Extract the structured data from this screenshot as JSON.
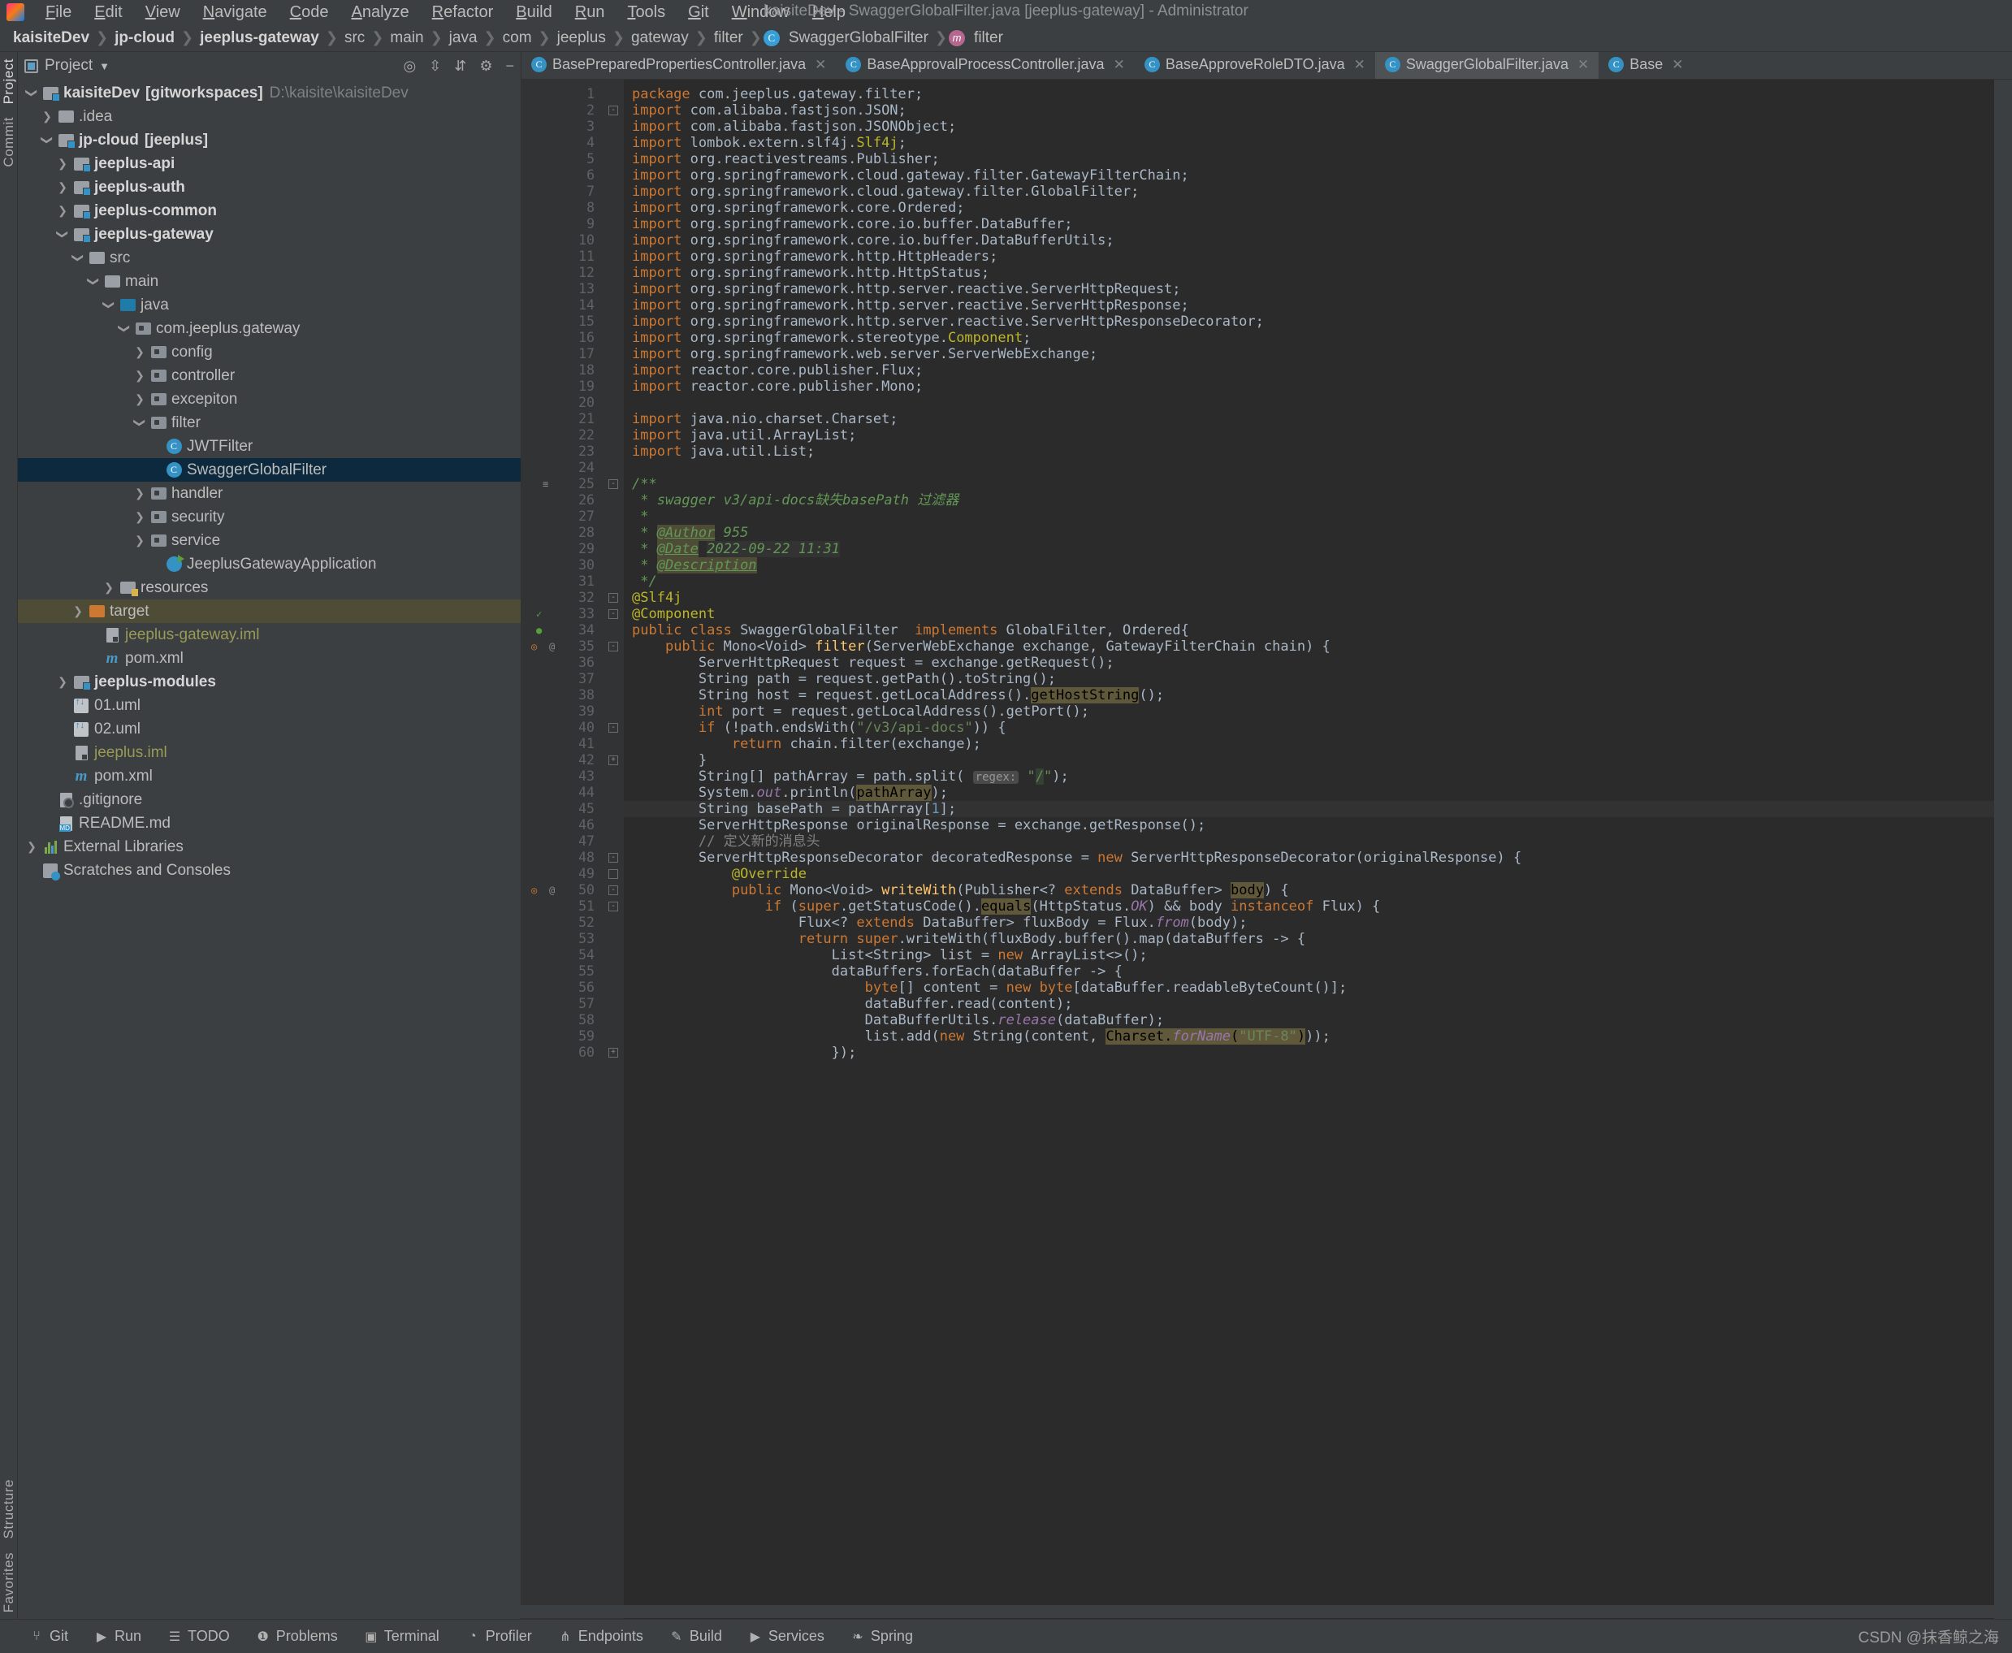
{
  "window": {
    "title": "kaisiteDev - SwaggerGlobalFilter.java [jeeplus-gateway] - Administrator"
  },
  "menubar": [
    {
      "label": "File"
    },
    {
      "label": "Edit"
    },
    {
      "label": "View"
    },
    {
      "label": "Navigate"
    },
    {
      "label": "Code"
    },
    {
      "label": "Analyze"
    },
    {
      "label": "Refactor"
    },
    {
      "label": "Build"
    },
    {
      "label": "Run"
    },
    {
      "label": "Tools"
    },
    {
      "label": "Git"
    },
    {
      "label": "Window"
    },
    {
      "label": "Help"
    }
  ],
  "breadcrumb": [
    {
      "label": "kaisiteDev",
      "bold": true
    },
    {
      "label": "jp-cloud",
      "bold": true
    },
    {
      "label": "jeeplus-gateway",
      "bold": true
    },
    {
      "label": "src",
      "bold": false
    },
    {
      "label": "main",
      "bold": false
    },
    {
      "label": "java",
      "bold": false
    },
    {
      "label": "com",
      "bold": false
    },
    {
      "label": "jeeplus",
      "bold": false
    },
    {
      "label": "gateway",
      "bold": false
    },
    {
      "label": "filter",
      "bold": false
    },
    {
      "label": "SwaggerGlobalFilter",
      "bold": false,
      "badge": "C"
    },
    {
      "label": "filter",
      "bold": false,
      "badge": "m"
    }
  ],
  "left_rail": {
    "top": [
      "Project",
      "Commit"
    ],
    "bottom": [
      "Structure",
      "Favorites"
    ]
  },
  "project_panel": {
    "title": "Project",
    "toolbar_icons": [
      "target-icon",
      "expand-all-icon",
      "collapse-all-icon",
      "gear-icon",
      "hide-icon"
    ],
    "tree": [
      {
        "depth": 0,
        "arrow": "down",
        "icon": "module",
        "label": "kaisiteDev",
        "bold": true,
        "suffix": "[gitworkspaces]",
        "path": "D:\\kaisite\\kaisiteDev"
      },
      {
        "depth": 1,
        "arrow": "right",
        "icon": "folder",
        "label": ".idea"
      },
      {
        "depth": 1,
        "arrow": "down",
        "icon": "module",
        "label": "jp-cloud",
        "bold": true,
        "suffix": "[jeeplus]"
      },
      {
        "depth": 2,
        "arrow": "right",
        "icon": "module",
        "label": "jeeplus-api",
        "bold": true
      },
      {
        "depth": 2,
        "arrow": "right",
        "icon": "module",
        "label": "jeeplus-auth",
        "bold": true
      },
      {
        "depth": 2,
        "arrow": "right",
        "icon": "module",
        "label": "jeeplus-common",
        "bold": true
      },
      {
        "depth": 2,
        "arrow": "down",
        "icon": "module",
        "label": "jeeplus-gateway",
        "bold": true
      },
      {
        "depth": 3,
        "arrow": "down",
        "icon": "folder",
        "label": "src"
      },
      {
        "depth": 4,
        "arrow": "down",
        "icon": "folder",
        "label": "main"
      },
      {
        "depth": 5,
        "arrow": "down",
        "icon": "source",
        "label": "java"
      },
      {
        "depth": 6,
        "arrow": "down",
        "icon": "package",
        "label": "com.jeeplus.gateway"
      },
      {
        "depth": 7,
        "arrow": "right",
        "icon": "package",
        "label": "config"
      },
      {
        "depth": 7,
        "arrow": "right",
        "icon": "package",
        "label": "controller"
      },
      {
        "depth": 7,
        "arrow": "right",
        "icon": "package",
        "label": "excepiton"
      },
      {
        "depth": 7,
        "arrow": "down",
        "icon": "package",
        "label": "filter"
      },
      {
        "depth": 8,
        "arrow": "none",
        "icon": "class",
        "label": "JWTFilter"
      },
      {
        "depth": 8,
        "arrow": "none",
        "icon": "class",
        "label": "SwaggerGlobalFilter",
        "selected": true
      },
      {
        "depth": 7,
        "arrow": "right",
        "icon": "package",
        "label": "handler"
      },
      {
        "depth": 7,
        "arrow": "right",
        "icon": "package",
        "label": "security"
      },
      {
        "depth": 7,
        "arrow": "right",
        "icon": "package",
        "label": "service"
      },
      {
        "depth": 8,
        "arrow": "none",
        "icon": "runclass",
        "label": "JeeplusGatewayApplication"
      },
      {
        "depth": 5,
        "arrow": "right",
        "icon": "resources",
        "label": "resources"
      },
      {
        "depth": 3,
        "arrow": "right",
        "icon": "target",
        "label": "target",
        "highlighted": true
      },
      {
        "depth": 4,
        "arrow": "none",
        "icon": "iml",
        "label": "jeeplus-gateway.iml",
        "olive": true
      },
      {
        "depth": 4,
        "arrow": "none",
        "icon": "maven",
        "label": "pom.xml"
      },
      {
        "depth": 2,
        "arrow": "right",
        "icon": "module",
        "label": "jeeplus-modules",
        "bold": true
      },
      {
        "depth": 2,
        "arrow": "none",
        "icon": "uml",
        "label": "01.uml"
      },
      {
        "depth": 2,
        "arrow": "none",
        "icon": "uml",
        "label": "02.uml"
      },
      {
        "depth": 2,
        "arrow": "none",
        "icon": "iml",
        "label": "jeeplus.iml",
        "olive": true
      },
      {
        "depth": 2,
        "arrow": "none",
        "icon": "maven",
        "label": "pom.xml"
      },
      {
        "depth": 1,
        "arrow": "none",
        "icon": "gitignore",
        "label": ".gitignore"
      },
      {
        "depth": 1,
        "arrow": "none",
        "icon": "markdown",
        "label": "README.md"
      },
      {
        "depth": 0,
        "arrow": "right",
        "icon": "library",
        "label": "External Libraries"
      },
      {
        "depth": 0,
        "arrow": "none",
        "icon": "scratch",
        "label": "Scratches and Consoles"
      }
    ]
  },
  "editor": {
    "tabs": [
      {
        "label": "BasePreparedPropertiesController.java",
        "badge": "C",
        "active": false
      },
      {
        "label": "BaseApprovalProcessController.java",
        "badge": "C",
        "active": false
      },
      {
        "label": "BaseApproveRoleDTO.java",
        "badge": "C",
        "active": false
      },
      {
        "label": "SwaggerGlobalFilter.java",
        "badge": "C",
        "active": true
      },
      {
        "label": "Base",
        "badge": "C",
        "active": false
      }
    ],
    "current_line": 45,
    "lines": [
      {
        "n": 1,
        "html": "<span class=\"kw\">package</span> <span class=\"id\">com.jeeplus.gateway.filter</span><span class=\"id\">;</span>"
      },
      {
        "n": 2,
        "html": "<span class=\"kw\">import</span> <span class=\"id\">com.alibaba.fastjson.JSON;</span>"
      },
      {
        "n": 3,
        "html": "<span class=\"kw\">import</span> <span class=\"id\">com.alibaba.fastjson.JSONObject;</span>"
      },
      {
        "n": 4,
        "html": "<span class=\"kw\">import</span> <span class=\"id\">lombok.extern.slf4j.</span><span class=\"ann\">Slf4j</span><span class=\"id\">;</span>"
      },
      {
        "n": 5,
        "html": "<span class=\"kw\">import</span> <span class=\"id\">org.reactivestreams.Publisher;</span>"
      },
      {
        "n": 6,
        "html": "<span class=\"kw\">import</span> <span class=\"id\">org.springframework.cloud.gateway.filter.GatewayFilterChain;</span>"
      },
      {
        "n": 7,
        "html": "<span class=\"kw\">import</span> <span class=\"id\">org.springframework.cloud.gateway.filter.GlobalFilter;</span>"
      },
      {
        "n": 8,
        "html": "<span class=\"kw\">import</span> <span class=\"id\">org.springframework.core.Ordered;</span>"
      },
      {
        "n": 9,
        "html": "<span class=\"kw\">import</span> <span class=\"id\">org.springframework.core.io.buffer.DataBuffer;</span>"
      },
      {
        "n": 10,
        "html": "<span class=\"kw\">import</span> <span class=\"id\">org.springframework.core.io.buffer.DataBufferUtils;</span>"
      },
      {
        "n": 11,
        "html": "<span class=\"kw\">import</span> <span class=\"id\">org.springframework.http.HttpHeaders;</span>"
      },
      {
        "n": 12,
        "html": "<span class=\"kw\">import</span> <span class=\"id\">org.springframework.http.HttpStatus;</span>"
      },
      {
        "n": 13,
        "html": "<span class=\"kw\">import</span> <span class=\"id\">org.springframework.http.server.reactive.ServerHttpRequest;</span>"
      },
      {
        "n": 14,
        "html": "<span class=\"kw\">import</span> <span class=\"id\">org.springframework.http.server.reactive.ServerHttpResponse;</span>"
      },
      {
        "n": 15,
        "html": "<span class=\"kw\">import</span> <span class=\"id\">org.springframework.http.server.reactive.ServerHttpResponseDecorator;</span>"
      },
      {
        "n": 16,
        "html": "<span class=\"kw\">import</span> <span class=\"id\">org.springframework.stereotype.</span><span class=\"ann\">Component</span><span class=\"id\">;</span>"
      },
      {
        "n": 17,
        "html": "<span class=\"kw\">import</span> <span class=\"id\">org.springframework.web.server.ServerWebExchange;</span>"
      },
      {
        "n": 18,
        "html": "<span class=\"kw\">import</span> <span class=\"id\">reactor.core.publisher.Flux;</span>"
      },
      {
        "n": 19,
        "html": "<span class=\"kw\">import</span> <span class=\"id\">reactor.core.publisher.Mono;</span>"
      },
      {
        "n": 20,
        "html": ""
      },
      {
        "n": 21,
        "html": "<span class=\"kw\">import</span> <span class=\"id\">java.nio.charset.Charset;</span>"
      },
      {
        "n": 22,
        "html": "<span class=\"kw\">import</span> <span class=\"id\">java.util.ArrayList;</span>"
      },
      {
        "n": 23,
        "html": "<span class=\"kw\">import</span> <span class=\"id\">java.util.List;</span>"
      },
      {
        "n": 24,
        "html": ""
      },
      {
        "n": 25,
        "html": "<span class=\"jdoc\">/**</span>"
      },
      {
        "n": 26,
        "html": "<span class=\"jdoc\"> * swagger v3/api-docs缺失basePath 过滤器</span>"
      },
      {
        "n": 27,
        "html": "<span class=\"jdoc\"> *</span>"
      },
      {
        "n": 28,
        "html": "<span class=\"jdoc\"> * </span><span class=\"jtag\">@Author</span><span class=\"jdoc\"> 955</span>"
      },
      {
        "n": 29,
        "html": "<span class=\"jdoc\"> * </span><span class=\"jtag\">@Date</span><span class=\"jdoc\"> </span><span class=\"jdoc\" style=\"background:#333\">2022-09-22 11:31</span>"
      },
      {
        "n": 30,
        "html": "<span class=\"jdoc\"> * </span><span class=\"jtag\">@Description</span>"
      },
      {
        "n": 31,
        "html": "<span class=\"jdoc\"> */</span>"
      },
      {
        "n": 32,
        "html": "<span class=\"ann\">@Slf4j</span>"
      },
      {
        "n": 33,
        "html": "<span class=\"ann\">@Component</span>"
      },
      {
        "n": 34,
        "html": "<span class=\"kw\">public</span> <span class=\"kw\">class</span> <span class=\"id\">SwaggerGlobalFilter</span>  <span class=\"kw\">implements</span> <span class=\"id\">GlobalFilter, Ordered{</span>"
      },
      {
        "n": 35,
        "html": "    <span class=\"kw\">public</span> <span class=\"id\">Mono&lt;Void&gt; </span><span class=\"meth\">filter</span><span class=\"id\">(ServerWebExchange exchange, GatewayFilterChain chain) {</span>"
      },
      {
        "n": 36,
        "html": "        <span class=\"id\">ServerHttpRequest request = exchange.getRequest();</span>"
      },
      {
        "n": 37,
        "html": "        <span class=\"id\">String path = request.getPath().toString();</span>"
      },
      {
        "n": 38,
        "html": "        <span class=\"id\">String host = request.getLocalAddress().</span><span class=\"sel-hl\">getHostString</span><span class=\"id\">();</span>"
      },
      {
        "n": 39,
        "html": "        <span class=\"kw\">int</span> <span class=\"id\">port = request.getLocalAddress().getPort();</span>"
      },
      {
        "n": 40,
        "html": "        <span class=\"kw\">if</span> <span class=\"id\">(!path.endsWith(</span><span class=\"str\">\"/v3/api-docs\"</span><span class=\"id\">)) {</span>"
      },
      {
        "n": 41,
        "html": "            <span class=\"kw\">return</span> <span class=\"id\">chain.filter(exchange);</span>"
      },
      {
        "n": 42,
        "html": "        <span class=\"id\">}</span>"
      },
      {
        "n": 43,
        "html": "        <span class=\"id\">String[] pathArray = path.split(</span> <span class=\"hint\">regex:</span> <span class=\"str\">\"</span><span class=\"str ident-hl\">/</span><span class=\"str\">\"</span><span class=\"id\">);</span>"
      },
      {
        "n": 44,
        "html": "        <span class=\"id\">System.</span><span class=\"stat\">out</span><span class=\"id\">.println(</span><span class=\"sel-hl\">pathArray</span><span class=\"id\">);</span>"
      },
      {
        "n": 45,
        "html": "        <span class=\"id\">String basePath = pathArray[</span><span class=\"num\">1</span><span class=\"id\">];</span>"
      },
      {
        "n": 46,
        "html": "        <span class=\"id\">ServerHttpResponse originalResponse = exchange.getResponse();</span>"
      },
      {
        "n": 47,
        "html": "        <span class=\"cmt\">// 定义新的消息头</span>"
      },
      {
        "n": 48,
        "html": "        <span class=\"id\">ServerHttpResponseDecorator decoratedResponse = </span><span class=\"kw\">new</span> <span class=\"id\">ServerHttpResponseDecorator(originalResponse) {</span>"
      },
      {
        "n": 49,
        "html": "            <span class=\"ann\">@Override</span>"
      },
      {
        "n": 50,
        "html": "            <span class=\"kw\">public</span> <span class=\"id\">Mono&lt;Void&gt; </span><span class=\"meth\">writeWith</span><span class=\"id\">(Publisher&lt;? </span><span class=\"kw\">extends</span> <span class=\"id\">DataBuffer&gt; </span><span class=\"sel-hl\">body</span><span class=\"id\">) {</span>"
      },
      {
        "n": 51,
        "html": "                <span class=\"kw\">if</span> <span class=\"id\">(</span><span class=\"kw\">super</span><span class=\"id\">.getStatusCode().</span><span class=\"sel-hl\">equals</span><span class=\"id\">(HttpStatus.</span><span class=\"stat\">OK</span><span class=\"id\">) &amp;&amp; body </span><span class=\"kw\">instanceof</span> <span class=\"id\">Flux) {</span>"
      },
      {
        "n": 52,
        "html": "                    <span class=\"id\">Flux&lt;? </span><span class=\"kw\">extends</span> <span class=\"id\">DataBuffer&gt; fluxBody = Flux.</span><span class=\"stat\">from</span><span class=\"id\">(body);</span>"
      },
      {
        "n": 53,
        "html": "                    <span class=\"kw\">return</span> <span class=\"kw\">super</span><span class=\"id\">.writeWith(fluxBody.buffer().map(dataBuffers -&gt; {</span>"
      },
      {
        "n": 54,
        "html": "                        <span class=\"id\">List&lt;String&gt; list = </span><span class=\"kw\">new</span> <span class=\"id\">ArrayList&lt;&gt;();</span>"
      },
      {
        "n": 55,
        "html": "                        <span class=\"id\">dataBuffers.forEach(dataBuffer -&gt; {</span>"
      },
      {
        "n": 56,
        "html": "                            <span class=\"kw\">byte</span><span class=\"id\">[] content = </span><span class=\"kw\">new</span> <span class=\"kw\">byte</span><span class=\"id\">[dataBuffer.readableByteCount()];</span>"
      },
      {
        "n": 57,
        "html": "                            <span class=\"id\">dataBuffer.read(content);</span>"
      },
      {
        "n": 58,
        "html": "                            <span class=\"id\">DataBufferUtils.</span><span class=\"stat\">release</span><span class=\"id\">(dataBuffer);</span>"
      },
      {
        "n": 59,
        "html": "                            <span class=\"id\">list.add(</span><span class=\"kw\">new</span> <span class=\"id\">String(content, </span><span class=\"sel-hl\">Charset.</span><span class=\"stat sel-hl\">forName</span><span class=\"sel-hl\">(</span><span class=\"str sel-hl\">\"UTF-8\"</span><span class=\"sel-hl\">)</span><span class=\"id\">));</span>"
      },
      {
        "n": 60,
        "html": "                        <span class=\"id\">});</span>"
      }
    ]
  },
  "statusbar": {
    "items": [
      {
        "label": "Git",
        "icon": "git-icon"
      },
      {
        "label": "Run",
        "icon": "run-icon"
      },
      {
        "label": "TODO",
        "icon": "todo-icon"
      },
      {
        "label": "Problems",
        "icon": "problems-icon"
      },
      {
        "label": "Terminal",
        "icon": "terminal-icon"
      },
      {
        "label": "Profiler",
        "icon": "profiler-icon"
      },
      {
        "label": "Endpoints",
        "icon": "endpoints-icon"
      },
      {
        "label": "Build",
        "icon": "build-icon"
      },
      {
        "label": "Services",
        "icon": "services-icon"
      },
      {
        "label": "Spring",
        "icon": "spring-icon"
      }
    ],
    "watermark": "CSDN @抹香鲸之海"
  },
  "colors": {
    "chrome": "#3c3f41",
    "editor_bg": "#2b2b2b",
    "gutter_bg": "#313335",
    "selection": "#0d293e",
    "accent": "#3592c4",
    "keyword": "#cc7832",
    "string": "#6a8759",
    "number": "#6897bb",
    "annotation": "#bbb529",
    "comment": "#808080",
    "javadoc": "#629755",
    "method": "#ffc66d",
    "static_field": "#9876aa"
  }
}
